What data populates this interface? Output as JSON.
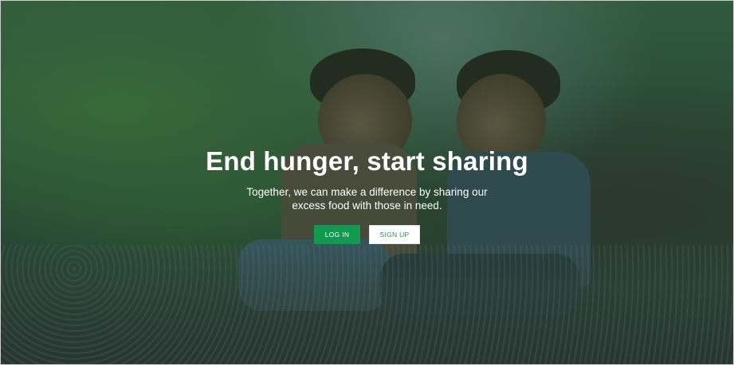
{
  "hero": {
    "title": "End hunger, start sharing",
    "subtitle": "Together, we can make a difference by sharing our excess food with those in need.",
    "login_label": "LOG IN",
    "signup_label": "SIGN UP"
  },
  "colors": {
    "primary": "#0f9a50",
    "overlay": "#1c4a30",
    "text": "#ffffff"
  }
}
